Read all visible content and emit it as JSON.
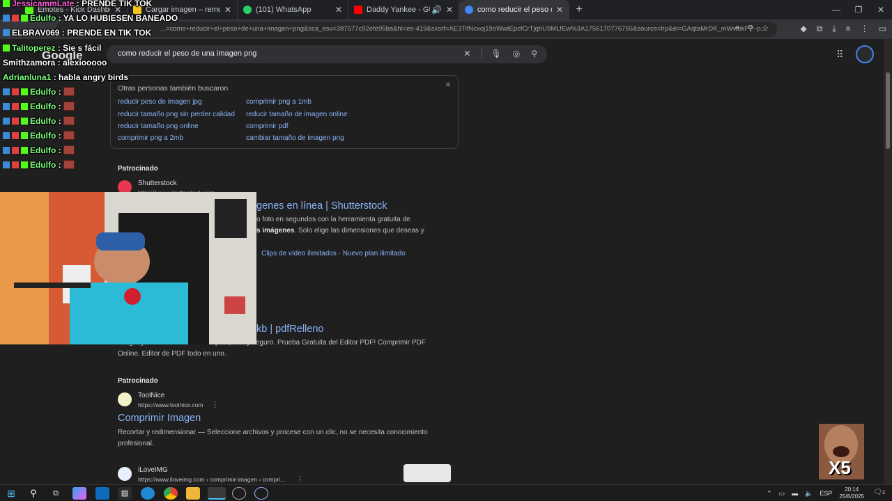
{
  "browser": {
    "tabs": [
      {
        "title": "Emotes - Kick Dashboard",
        "color": "#53fc18"
      },
      {
        "title": "Cargar imagen – remove.bg",
        "color": "#f5c518"
      },
      {
        "title": "(101) WhatsApp",
        "color": "#25d366"
      },
      {
        "title": "Daddy Yankee - GUAYA (Vi",
        "color": "#ff0000"
      },
      {
        "title": "como reducir el peso de una im",
        "color": "#4285f4"
      }
    ],
    "new_tab": "+",
    "url": "...=como+reducir+el+peso+de+una+imagen+png&sca_esv=387577c92efe95ba&hl=es-419&sxsrf=AE3TifNcxoj19oWwtEpcfCrTjqhU9MLfEw%3A1756170776755&source=hp&ei=GAqtaMrDK_mWwbkP7--p..."
  },
  "google": {
    "logo": "Google",
    "query": "como reducir el peso de una imagen png",
    "related": {
      "heading": "Otras personas también buscaron",
      "links": [
        "reducir peso de imagen jpg",
        "comprimir png a 1mb",
        "reducir tamaño png sin perder calidad",
        "reducir tamaño de imagen online",
        "reducir tamaño png online",
        "comprimir pdf",
        "comprimir png a 2mb",
        "cambiar tamaño de imagen png"
      ]
    },
    "results": [
      {
        "sponsored": "Patrocinado",
        "site": "Shutterstock",
        "url": "https://www.shutterstock.com",
        "title": "genes en línea | Shutterstock",
        "snippet_1": "o foto en segundos con la herramienta gratuita de",
        "snippet_2_bold": "s imágenes",
        "snippet_2": ". Solo elige las dimensiones que deseas y",
        "sitelinks": "Clips de vídeo ilimitados · Nuevo plan ilimitado"
      },
      {
        "title": "kb | pdfRelleno",
        "snippet_1": "Cargar y Editar PDF Online. Rápido, fácil y seguro. Prueba Gratuita del Editor PDF! Comprimir PDF",
        "snippet_2": "Online. Editor de PDF todo en uno."
      },
      {
        "sponsored": "Patrocinado",
        "site": "ToolNice",
        "url": "https://www.toolnice.com",
        "title": "Comprimir Imagen",
        "snippet_1": "Recortar y redimensionar — Seleccione archivos y procese con un clic, no se necesita conocimiento",
        "snippet_2": "profesional."
      },
      {
        "site": "iLoveIMG",
        "url": "https://www.iloveimg.com › comprimir-imagen › compri..."
      }
    ]
  },
  "chat": [
    {
      "user": "JessicammLate",
      "msg": "PRENDE TIK TOK",
      "color": "#ff5fd7"
    },
    {
      "user": "Edulfo",
      "msg": "YA LO HUBIESEN BANEADO",
      "color": "#7fff7f"
    },
    {
      "user": "ELBRAV069",
      "msg": "PRENDE EN TIK TOK",
      "color": "#ffffff"
    },
    {
      "user": "Talitoperez",
      "msg": "Sie s fácil",
      "color": "#7fff7f"
    },
    {
      "user": "Smithzamora",
      "msg": "alexiooooo",
      "color": "#ffffff"
    },
    {
      "user": "Adrianluna1",
      "msg": "habla angry birds",
      "color": "#7fff7f"
    },
    {
      "user": "Edulfo",
      "msg": "",
      "color": "#7fff7f"
    },
    {
      "user": "Edulfo",
      "msg": "",
      "color": "#7fff7f"
    },
    {
      "user": "Edulfo",
      "msg": "",
      "color": "#7fff7f"
    },
    {
      "user": "Edulfo",
      "msg": "",
      "color": "#7fff7f"
    },
    {
      "user": "Edulfo",
      "msg": "",
      "color": "#7fff7f"
    },
    {
      "user": "Edulfo",
      "msg": "",
      "color": "#7fff7f"
    }
  ],
  "overlay": {
    "multiplier": "X5"
  },
  "taskbar": {
    "lang": "ESP",
    "time": "20:14",
    "date": "25/8/2025",
    "notif": "2"
  }
}
